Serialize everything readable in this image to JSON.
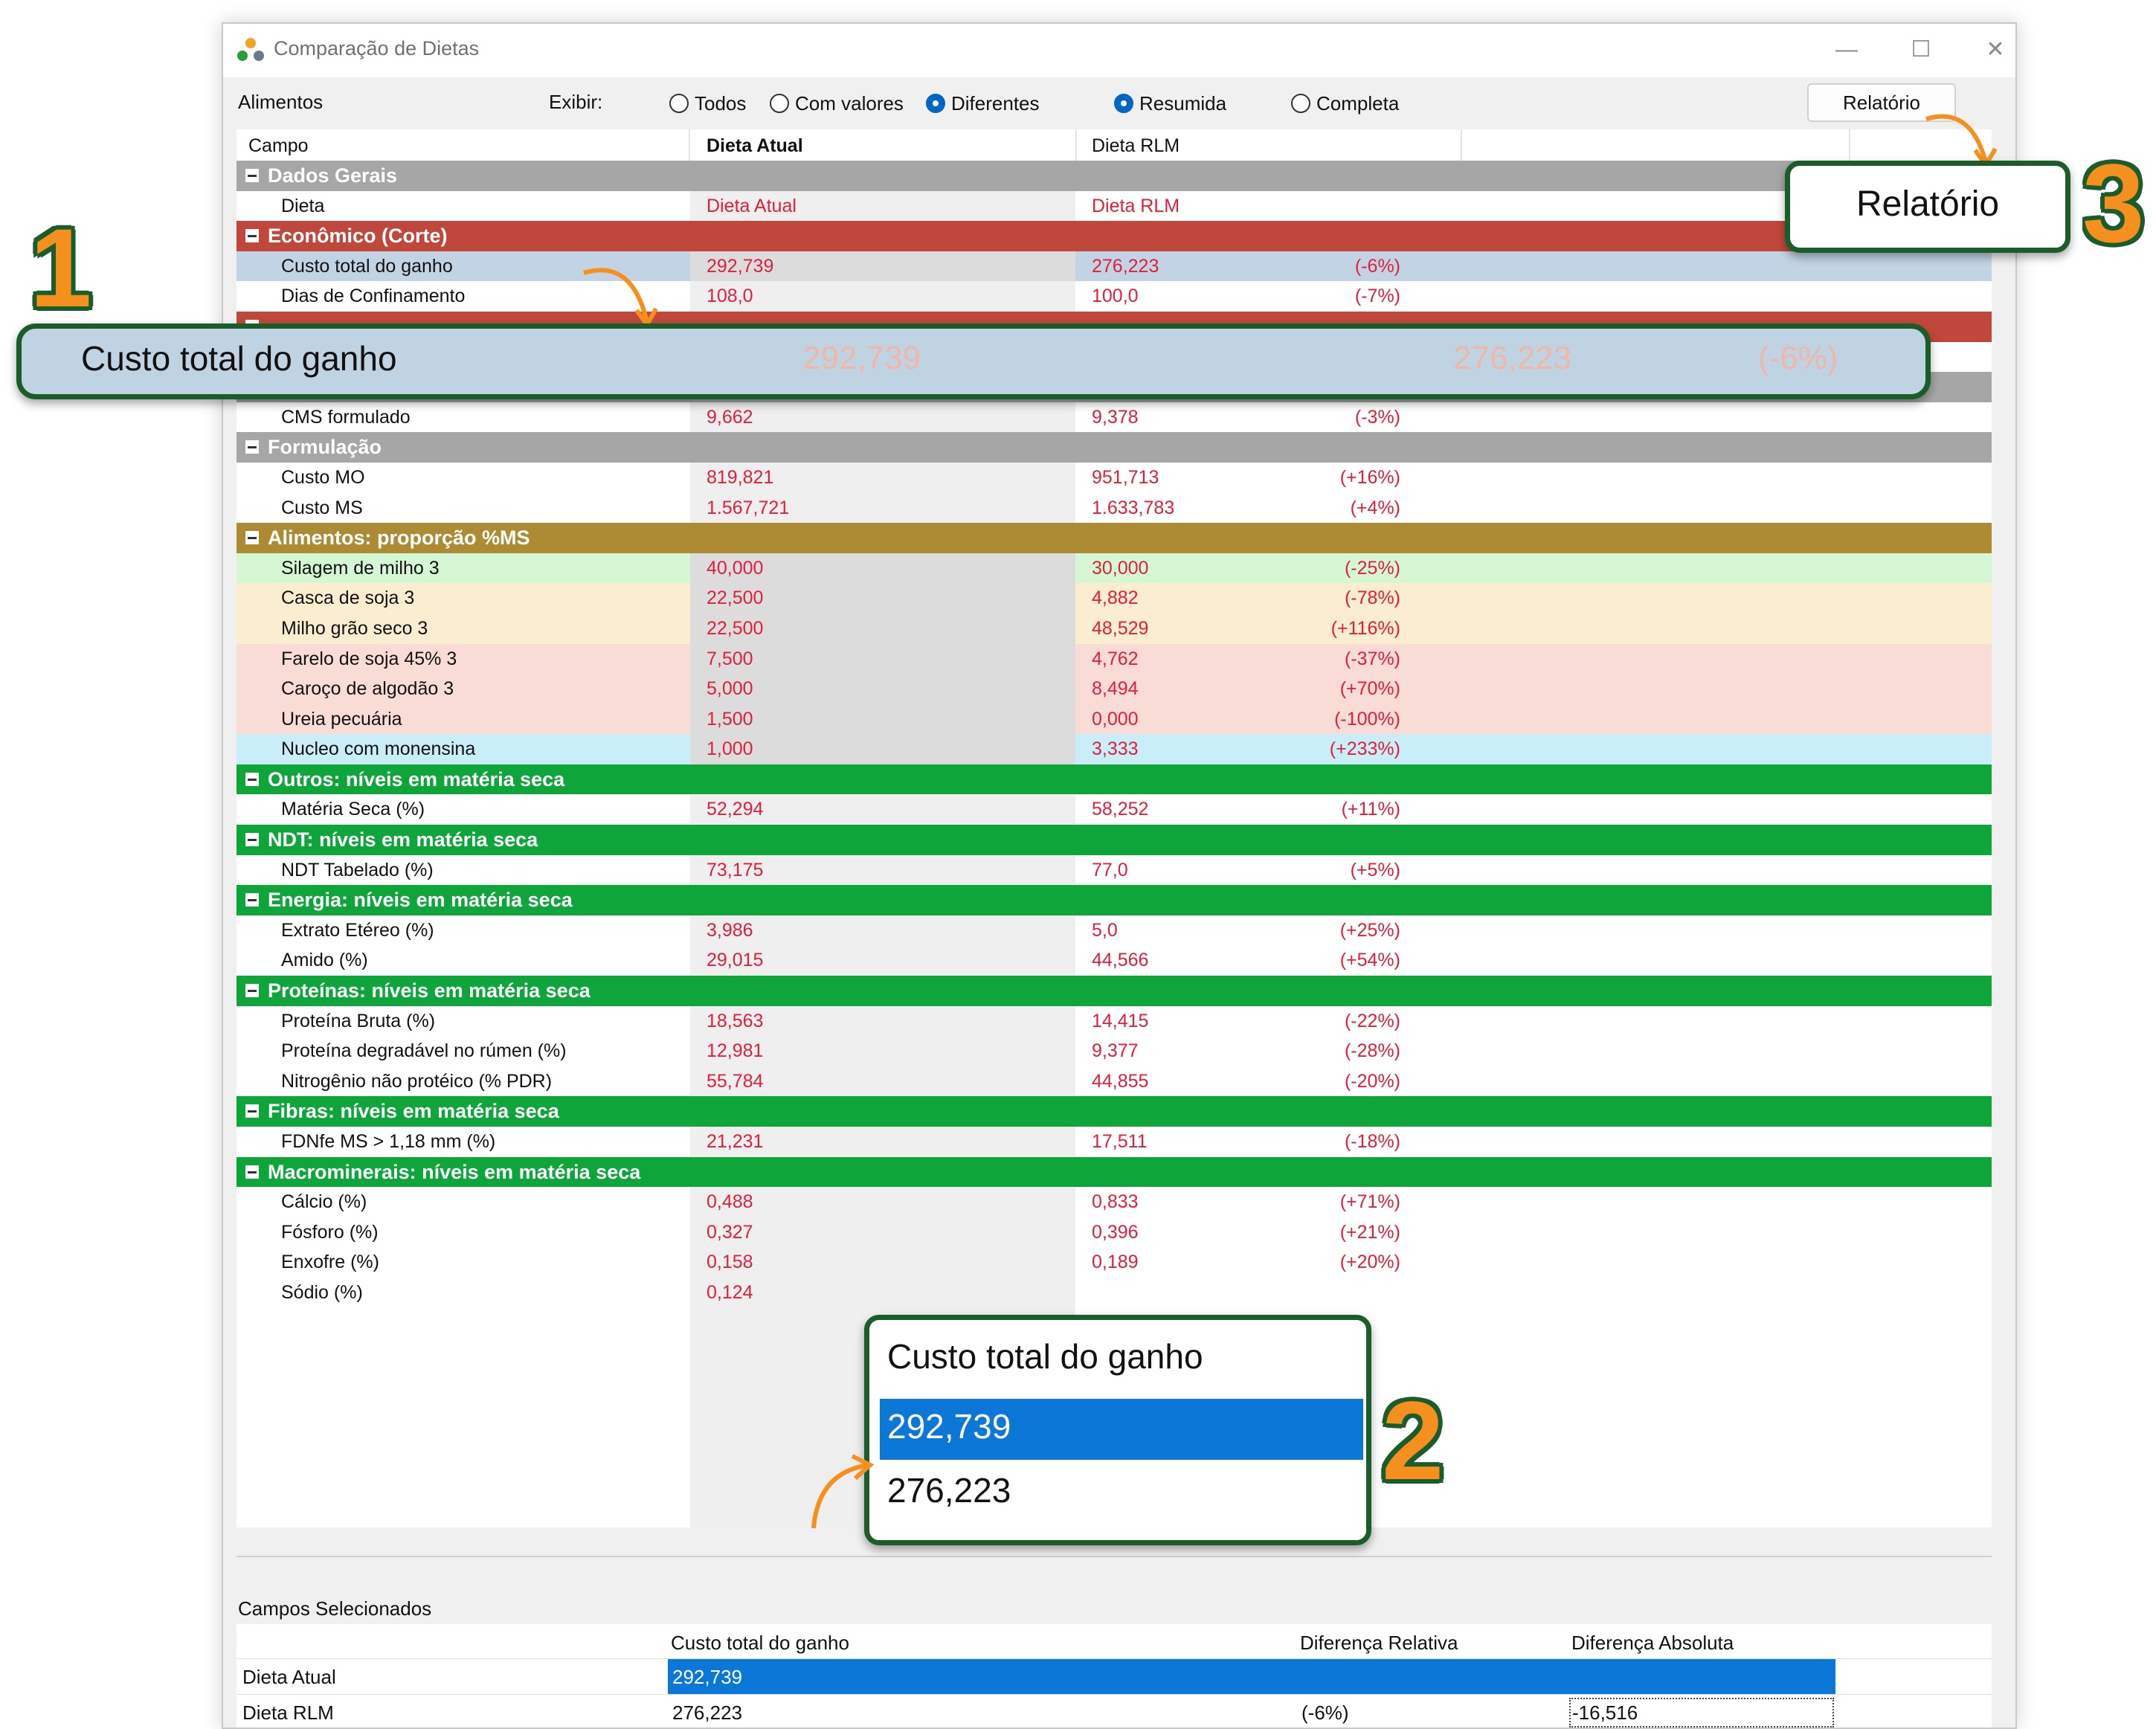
{
  "window": {
    "title": "Comparação de Dietas"
  },
  "toolbar": {
    "alimentos_label": "Alimentos",
    "exibir_label": "Exibir:",
    "radios": [
      {
        "label": "Todos",
        "checked": false
      },
      {
        "label": "Com valores",
        "checked": false
      },
      {
        "label": "Diferentes",
        "checked": true
      },
      {
        "label": "Resumida",
        "checked": true
      },
      {
        "label": "Completa",
        "checked": false
      }
    ],
    "report_label": "Relatório"
  },
  "grid": {
    "columns": [
      "Campo",
      "Dieta Atual",
      "Dieta RLM"
    ],
    "rows": [
      {
        "type": "group",
        "label": "Dados Gerais",
        "color": "#a6a6a6"
      },
      {
        "type": "item",
        "name": "Dieta",
        "v1": "Dieta Atual",
        "v2": "Dieta RLM",
        "diff": "",
        "bg": "#ffffff"
      },
      {
        "type": "group",
        "label": "Econômico (Corte)",
        "color": "#c0473b"
      },
      {
        "type": "item",
        "name": "Custo total do ganho",
        "v1": "292,739",
        "v2": "276,223",
        "diff": "(-6%)",
        "bg": "#c2d4e4"
      },
      {
        "type": "item",
        "name": "Dias de Confinamento",
        "v1": "108,0",
        "v2": "100,0",
        "diff": "(-7%)",
        "bg": "#ffffff"
      },
      {
        "type": "group",
        "label": "",
        "color": "#c0473b"
      },
      {
        "type": "item",
        "name": "",
        "v1": "",
        "v2": "",
        "diff": "",
        "bg": "#ffffff"
      },
      {
        "type": "group",
        "label": "Consumo",
        "color": "#a6a6a6"
      },
      {
        "type": "item",
        "name": "CMS formulado",
        "v1": "9,662",
        "v2": "9,378",
        "diff": "(-3%)",
        "bg": "#ffffff"
      },
      {
        "type": "group",
        "label": "Formulação",
        "color": "#a6a6a6"
      },
      {
        "type": "item",
        "name": "Custo MO",
        "v1": "819,821",
        "v2": "951,713",
        "diff": "(+16%)",
        "bg": "#ffffff"
      },
      {
        "type": "item",
        "name": "Custo MS",
        "v1": "1.567,721",
        "v2": "1.633,783",
        "diff": "(+4%)",
        "bg": "#ffffff"
      },
      {
        "type": "group",
        "label": "Alimentos: proporção %MS",
        "color": "#ad8b34"
      },
      {
        "type": "item",
        "name": "Silagem de milho 3",
        "v1": "40,000",
        "v2": "30,000",
        "diff": "(-25%)",
        "bg": "#d5f7d3"
      },
      {
        "type": "item",
        "name": "Casca de soja 3",
        "v1": "22,500",
        "v2": "4,882",
        "diff": "(-78%)",
        "bg": "#fbeed0"
      },
      {
        "type": "item",
        "name": "Milho grão seco 3",
        "v1": "22,500",
        "v2": "48,529",
        "diff": "(+116%)",
        "bg": "#fbeed0"
      },
      {
        "type": "item",
        "name": "Farelo de soja 45% 3",
        "v1": "7,500",
        "v2": "4,762",
        "diff": "(-37%)",
        "bg": "#fadcd7"
      },
      {
        "type": "item",
        "name": "Caroço de algodão 3",
        "v1": "5,000",
        "v2": "8,494",
        "diff": "(+70%)",
        "bg": "#fadcd7"
      },
      {
        "type": "item",
        "name": "Ureia pecuária",
        "v1": "1,500",
        "v2": "0,000",
        "diff": "(-100%)",
        "bg": "#fadcd7"
      },
      {
        "type": "item",
        "name": "Nucleo com monensina",
        "v1": "1,000",
        "v2": "3,333",
        "diff": "(+233%)",
        "bg": "#c9eef7"
      },
      {
        "type": "group",
        "label": "Outros: níveis em matéria seca",
        "color": "#0ea53b"
      },
      {
        "type": "item",
        "name": "Matéria Seca (%)",
        "v1": "52,294",
        "v2": "58,252",
        "diff": "(+11%)",
        "bg": "#ffffff"
      },
      {
        "type": "group",
        "label": "NDT: níveis em matéria seca",
        "color": "#0ea53b"
      },
      {
        "type": "item",
        "name": "NDT Tabelado (%)",
        "v1": "73,175",
        "v2": "77,0",
        "diff": "(+5%)",
        "bg": "#ffffff"
      },
      {
        "type": "group",
        "label": "Energia: níveis em matéria seca",
        "color": "#0ea53b"
      },
      {
        "type": "item",
        "name": "Extrato Etéreo (%)",
        "v1": "3,986",
        "v2": "5,0",
        "diff": "(+25%)",
        "bg": "#ffffff"
      },
      {
        "type": "item",
        "name": "Amido (%)",
        "v1": "29,015",
        "v2": "44,566",
        "diff": "(+54%)",
        "bg": "#ffffff"
      },
      {
        "type": "group",
        "label": "Proteínas: níveis em matéria seca",
        "color": "#0ea53b"
      },
      {
        "type": "item",
        "name": "Proteína Bruta (%)",
        "v1": "18,563",
        "v2": "14,415",
        "diff": "(-22%)",
        "bg": "#ffffff"
      },
      {
        "type": "item",
        "name": "Proteína degradável no rúmen (%)",
        "v1": "12,981",
        "v2": "9,377",
        "diff": "(-28%)",
        "bg": "#ffffff"
      },
      {
        "type": "item",
        "name": "Nitrogênio não protéico (% PDR)",
        "v1": "55,784",
        "v2": "44,855",
        "diff": "(-20%)",
        "bg": "#ffffff"
      },
      {
        "type": "group",
        "label": "Fibras: níveis em matéria seca",
        "color": "#0ea53b"
      },
      {
        "type": "item",
        "name": "FDNfe MS > 1,18 mm (%)",
        "v1": "21,231",
        "v2": "17,511",
        "diff": "(-18%)",
        "bg": "#ffffff"
      },
      {
        "type": "group",
        "label": "Macrominerais: níveis em matéria seca",
        "color": "#0ea53b"
      },
      {
        "type": "item",
        "name": "Cálcio (%)",
        "v1": "0,488",
        "v2": "0,833",
        "diff": "(+71%)",
        "bg": "#ffffff"
      },
      {
        "type": "item",
        "name": "Fósforo (%)",
        "v1": "0,327",
        "v2": "0,396",
        "diff": "(+21%)",
        "bg": "#ffffff"
      },
      {
        "type": "item",
        "name": "Enxofre (%)",
        "v1": "0,158",
        "v2": "0,189",
        "diff": "(+20%)",
        "bg": "#ffffff"
      },
      {
        "type": "item",
        "name": "Sódio (%)",
        "v1": "0,124",
        "v2": "",
        "diff": "",
        "bg": "#ffffff"
      }
    ]
  },
  "selected": {
    "title": "Campos Selecionados",
    "headers": [
      "Custo total do ganho",
      "Diferença Relativa",
      "Diferença Absoluta"
    ],
    "rows": [
      {
        "label": "Dieta Atual",
        "value": "292,739",
        "rel": "",
        "abs": ""
      },
      {
        "label": "Dieta RLM",
        "value": "276,223",
        "rel": "(-6%)",
        "abs": "-16,516"
      }
    ]
  },
  "callouts": {
    "one": {
      "number": "1",
      "label": "Custo total do ganho",
      "v1": "292,739",
      "v2": "276,223",
      "diff": "(-6%)"
    },
    "two": {
      "number": "2",
      "title": "Custo total do ganho",
      "selected": "292,739",
      "other": "276,223"
    },
    "three": {
      "number": "3",
      "label": "Relatório"
    }
  }
}
